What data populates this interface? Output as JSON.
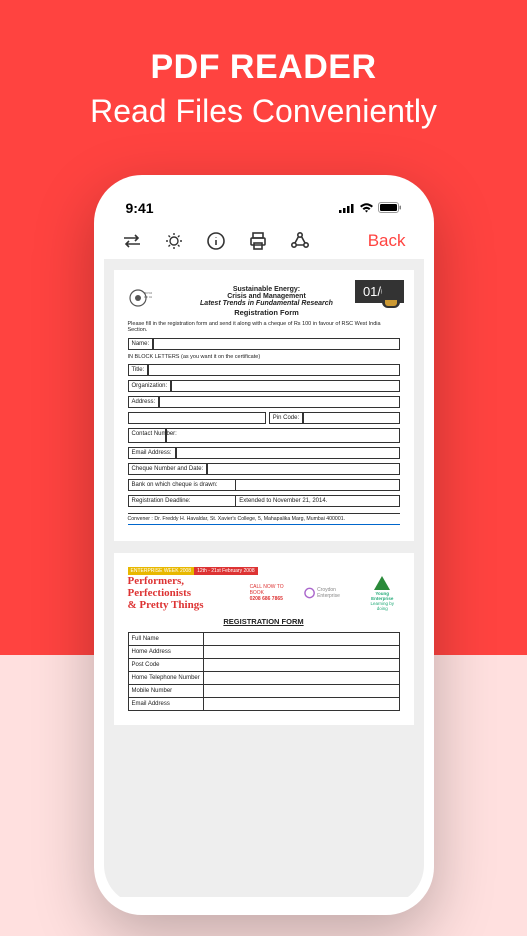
{
  "hero": {
    "title": "PDF READER",
    "subtitle": "Read Files Conveniently"
  },
  "status": {
    "time": "9:41"
  },
  "toolbar": {
    "back": "Back"
  },
  "page_counter": "01/02",
  "doc1": {
    "t1": "Sustainable Energy:",
    "t2": "Crisis and Management",
    "t3": "Latest Trends in Fundamental Research",
    "t4": "Registration Form",
    "instr": "Please fill in the registration form and send it along with a cheque of Rs 100 in favour of RSC West India Section.",
    "block_note": "IN BLOCK LETTERS (as you want it on the certificate)",
    "labels": {
      "name": "Name:",
      "title": "Title:",
      "org": "Organization:",
      "address": "Address:",
      "pin": "Pin Code:",
      "contact": "Contact Number:",
      "email": "Email Address:",
      "cheque": "Cheque Number and Date:",
      "bank": "Bank on which cheque is drawn:",
      "deadline": "Registration Deadline:"
    },
    "deadline_value": "Extended to November 21, 2014.",
    "convener": "Convener : Dr. Freddy H. Havaldar, St. Xavier's College, 5, Mahapalika Marg, Mumbai 400001."
  },
  "doc2": {
    "tag1": "ENTERPRISE WEEK 2008",
    "tag2": "12th - 21st February 2008",
    "title1": "Performers, Perfectionists",
    "title2": "& Pretty Things",
    "call1": "CALL NOW TO BOOK",
    "call2": "0208 686 7865",
    "logo_ce": "Croydon Enterprise",
    "logo_ye1": "Young Enterprise",
    "logo_ye2": "Learning by doing",
    "reg": "REGISTRATION FORM",
    "fields": [
      "Full Name",
      "Home Address",
      "Post Code",
      "Home Telephone Number",
      "Mobile Number",
      "Email Address"
    ]
  }
}
